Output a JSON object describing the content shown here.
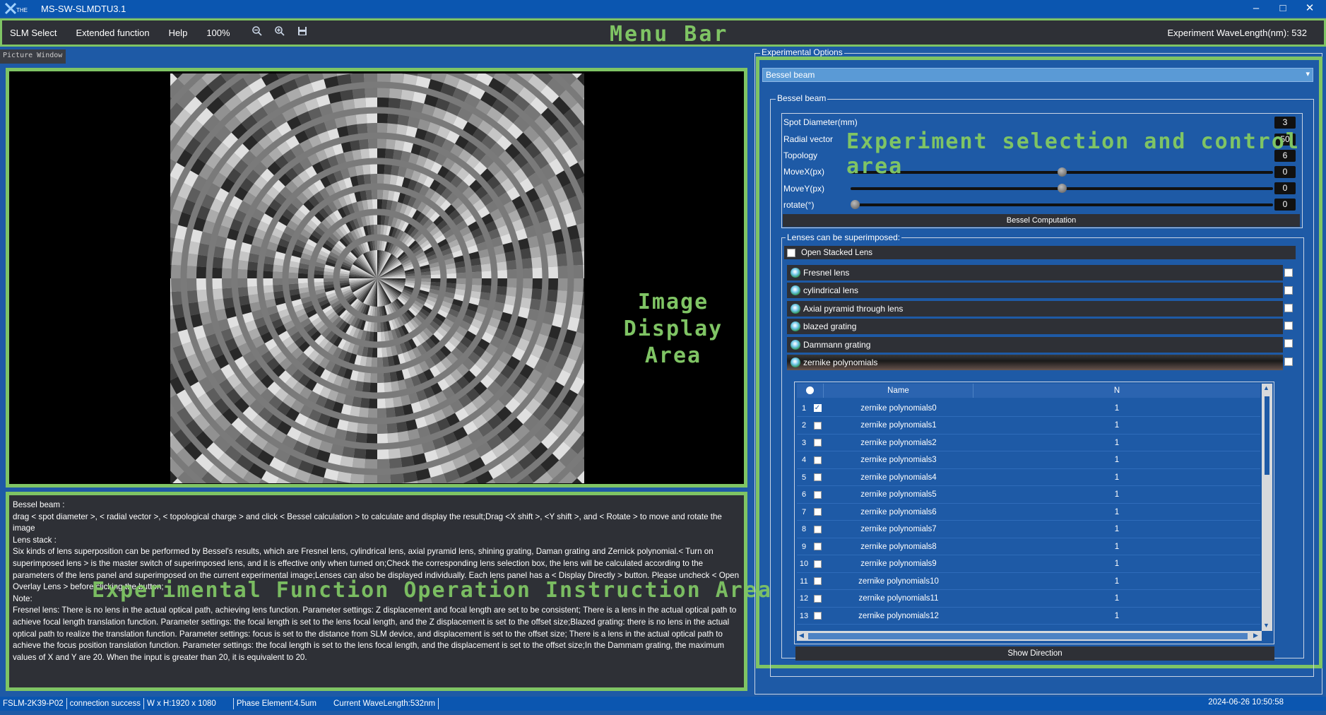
{
  "window": {
    "title": "MS-SW-SLMDTU3.1",
    "logo_text": "THE"
  },
  "menu": {
    "items": [
      "SLM Select",
      "Extended function",
      "Help",
      "100%"
    ],
    "wavelength_label": "Experiment WaveLength(nm):  532",
    "overlay_label": "Menu Bar"
  },
  "picture": {
    "tab_label": "Picture Window",
    "overlay_label_line1": "Image",
    "overlay_label_line2": "Display Area"
  },
  "instructions": {
    "paragraphs": [
      "Bessel beam :",
      "drag < spot diameter >, < radial vector >, < topological charge > and click < Bessel calculation > to calculate and display the result;Drag <X shift >, <Y shift >, and < Rotate > to move and rotate the image",
      "Lens stack :",
      "Six kinds of lens superposition can be performed by Bessel's results, which are Fresnel lens, cylindrical lens, axial pyramid lens, shining grating, Daman grating and Zernick polynomial.< Turn on superimposed lens > is the master switch of superimposed lens, and it is effective only when turned on;Check the corresponding lens selection box, the lens will be calculated according to the parameters of the lens panel and superimposed on the current experimental image;Lenses can also be displayed individually. Each lens panel has a < Display Directly > button. Please uncheck < Open Overlay Lens > before clicking the button;",
      "Note:",
      "Fresnel lens: There is no lens in the actual optical path, achieving lens function. Parameter settings: Z displacement and focal length are set to be consistent; There is a lens in the actual optical path to achieve focal length translation function. Parameter settings: the focal length is set to the lens focal length, and the Z displacement is set to the offset size;Blazed grating: there is no lens in the actual optical path to realize the translation function. Parameter settings: focus is set to the distance from SLM device, and displacement is set to the offset size; There is a lens in the actual optical path to achieve the focus position translation function. Parameter settings: the focal length is set to the lens focal length, and the displacement is set to the offset size;In the Dammam grating, the maximum values of X and Y are 20. When the input is greater than 20, it is equivalent to 20."
    ],
    "overlay_label": "Experimental Function Operation Instruction Area"
  },
  "experiment": {
    "group_title": "Experimental Options",
    "selected": "Bessel beam",
    "overlay_label": "Experiment selection and control area",
    "bessel_group_title": "Bessel beam",
    "params": [
      {
        "label": "Spot Diameter(mm)",
        "value": "3"
      },
      {
        "label": "Radial vector",
        "value": "50"
      },
      {
        "label": "Topology",
        "value": "6"
      },
      {
        "label": "MoveX(px)",
        "value": "0",
        "slider": 0.5
      },
      {
        "label": "MoveY(px)",
        "value": "0",
        "slider": 0.5
      },
      {
        "label": "rotate(°)",
        "value": "0",
        "slider": 0.0
      }
    ],
    "compute_button": "Bessel Computation",
    "lens_group_title": "Lenses can be superimposed:",
    "open_stacked_label": "Open Stacked Lens",
    "lenses": [
      "Fresnel lens",
      "cylindrical lens",
      "Axial pyramid through lens",
      "blazed grating",
      "Dammann grating",
      "zernike polynomials"
    ],
    "table": {
      "headers": [
        "Name",
        "N"
      ],
      "rows": [
        {
          "idx": "1",
          "name": "zernike polynomials0",
          "n": "1",
          "checked": true
        },
        {
          "idx": "2",
          "name": "zernike polynomials1",
          "n": "1",
          "checked": false
        },
        {
          "idx": "3",
          "name": "zernike polynomials2",
          "n": "1",
          "checked": false
        },
        {
          "idx": "4",
          "name": "zernike polynomials3",
          "n": "1",
          "checked": false
        },
        {
          "idx": "5",
          "name": "zernike polynomials4",
          "n": "1",
          "checked": false
        },
        {
          "idx": "6",
          "name": "zernike polynomials5",
          "n": "1",
          "checked": false
        },
        {
          "idx": "7",
          "name": "zernike polynomials6",
          "n": "1",
          "checked": false
        },
        {
          "idx": "8",
          "name": "zernike polynomials7",
          "n": "1",
          "checked": false
        },
        {
          "idx": "9",
          "name": "zernike polynomials8",
          "n": "1",
          "checked": false
        },
        {
          "idx": "10",
          "name": "zernike polynomials9",
          "n": "1",
          "checked": false
        },
        {
          "idx": "11",
          "name": "zernike polynomials10",
          "n": "1",
          "checked": false
        },
        {
          "idx": "12",
          "name": "zernike polynomials11",
          "n": "1",
          "checked": false
        },
        {
          "idx": "13",
          "name": "zernike polynomials12",
          "n": "1",
          "checked": false
        }
      ]
    },
    "show_direction_button": "Show Direction"
  },
  "status": {
    "device": "FSLM-2K39-P02",
    "connection": "connection success",
    "resolution": "W x H:1920 x 1080",
    "phase_element": "Phase Element:4.5um",
    "current_wavelength": "Current WaveLength:532nm",
    "datetime": "2024-06-26 10:50:58"
  },
  "colors": {
    "accent_green": "#7fc464",
    "panel_blue": "#1e5aa6",
    "dark_panel": "#2e3036"
  }
}
